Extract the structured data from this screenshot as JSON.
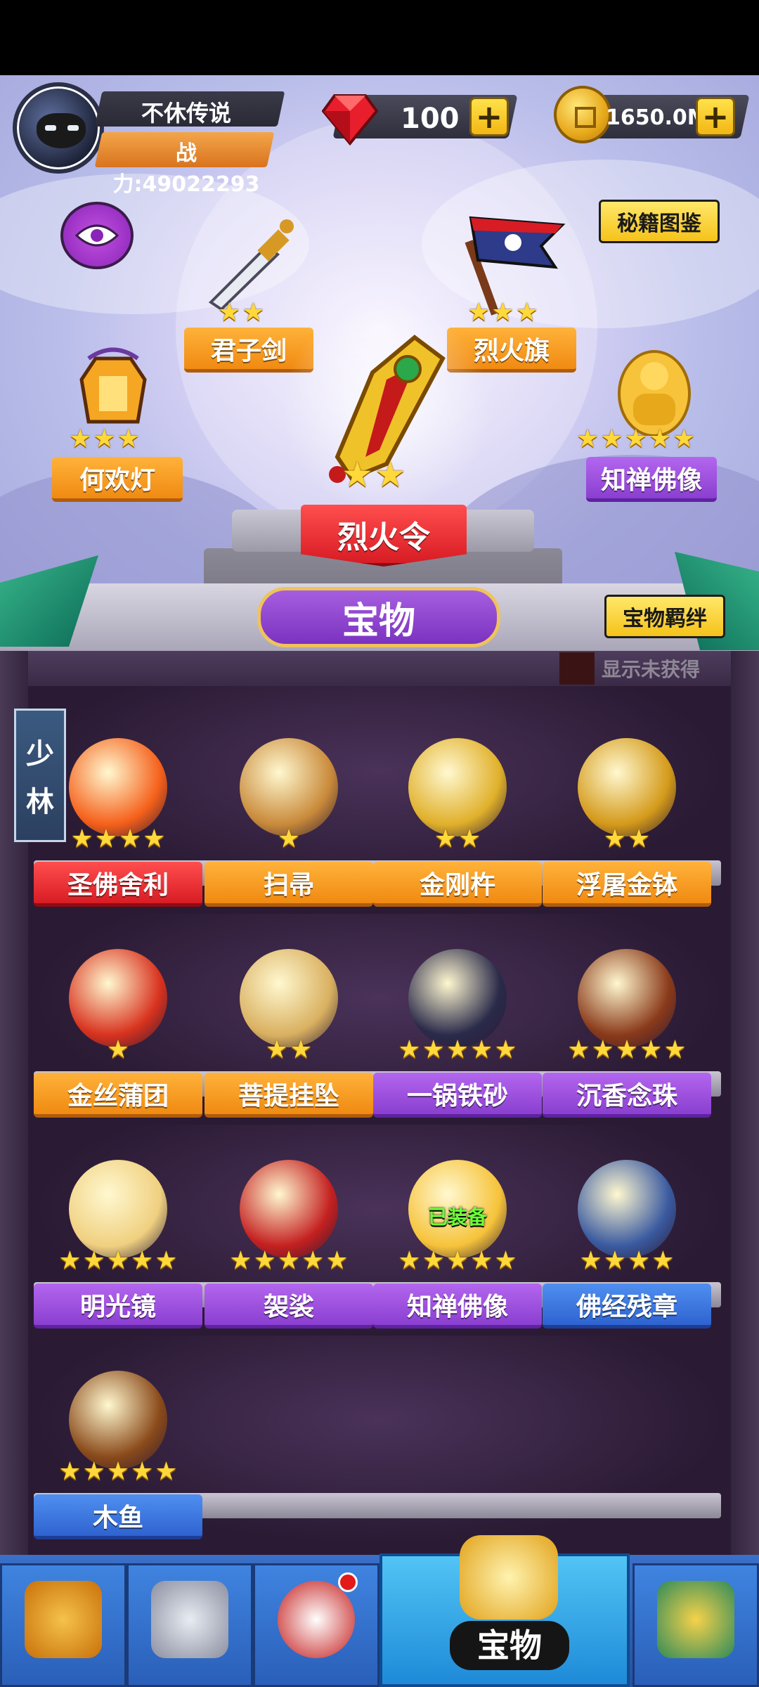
{
  "player": {
    "name": "不休传说",
    "power_label": "战力:",
    "power_value": "49022293"
  },
  "resources": {
    "gems": "100",
    "coins": "1650.0M",
    "plus": "+"
  },
  "top_buttons": {
    "codex": "秘籍图鉴",
    "bond": "宝物羁绊"
  },
  "showcase": {
    "items": [
      {
        "name": "君子剑",
        "stars": 2,
        "color": "orange"
      },
      {
        "name": "烈火旗",
        "stars": 3,
        "color": "orange"
      },
      {
        "name": "何欢灯",
        "stars": 3,
        "color": "orange"
      },
      {
        "name": "知禅佛像",
        "stars": 5,
        "color": "purple"
      }
    ],
    "selected": {
      "name": "烈火令",
      "stars": 2
    }
  },
  "category": {
    "title": "宝物",
    "show_unowned": "显示未获得",
    "sect": [
      "少",
      "林"
    ]
  },
  "shelf": {
    "equipped_text": "已装备",
    "items": [
      {
        "name": "圣佛舍利",
        "stars": 4,
        "color": "red"
      },
      {
        "name": "扫帚",
        "stars": 1,
        "color": "orange"
      },
      {
        "name": "金刚杵",
        "stars": 2,
        "color": "orange"
      },
      {
        "name": "浮屠金钵",
        "stars": 2,
        "color": "orange"
      },
      {
        "name": "金丝蒲团",
        "stars": 1,
        "color": "orange"
      },
      {
        "name": "菩提挂坠",
        "stars": 2,
        "color": "orange"
      },
      {
        "name": "一锅铁砂",
        "stars": 5,
        "color": "purple"
      },
      {
        "name": "沉香念珠",
        "stars": 5,
        "color": "purple"
      },
      {
        "name": "明光镜",
        "stars": 5,
        "color": "purple"
      },
      {
        "name": "袈裟",
        "stars": 5,
        "color": "purple"
      },
      {
        "name": "知禅佛像",
        "stars": 5,
        "color": "purple",
        "equipped": true
      },
      {
        "name": "佛经残章",
        "stars": 4,
        "color": "blue"
      },
      {
        "name": "木鱼",
        "stars": 5,
        "color": "blue"
      }
    ]
  },
  "navbar": {
    "active_label": "宝物"
  },
  "colors": {
    "orange": "#f08a12",
    "purple": "#8a3fd0",
    "blue": "#2f63d0",
    "red": "#d81c24",
    "star": "#ffd83a"
  }
}
